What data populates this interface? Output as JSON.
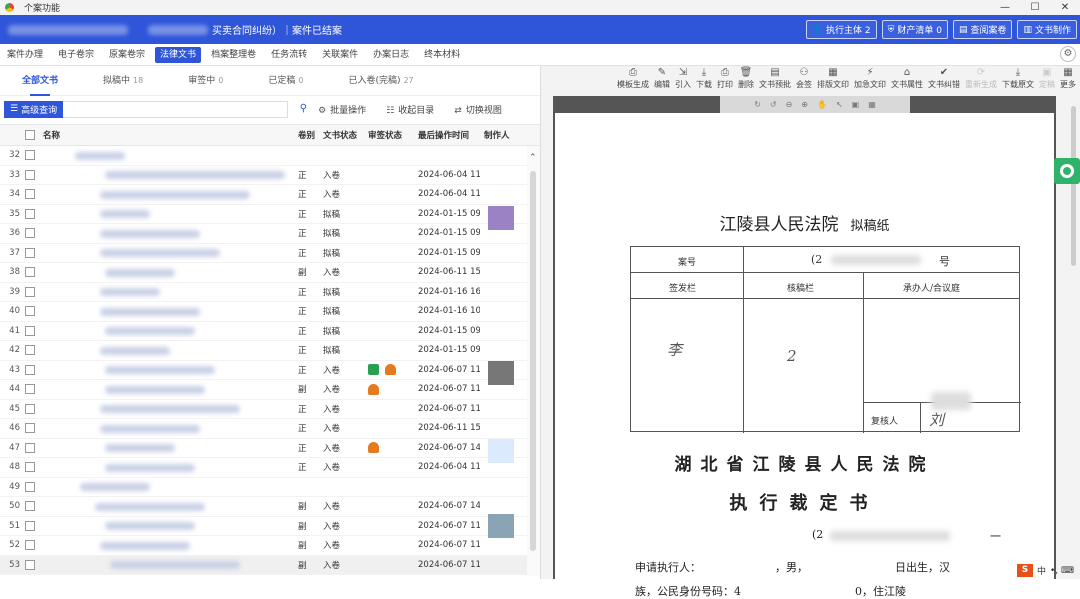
{
  "window": {
    "title": "个案功能",
    "buttons": [
      "—",
      "☐",
      "✕"
    ]
  },
  "header": {
    "case_status": "买卖合同纠纷）｜案件已结案",
    "buttons": [
      {
        "icon": "user-icon",
        "label": "执行主体 2"
      },
      {
        "icon": "shield-icon",
        "label": "财产清单 0"
      },
      {
        "icon": "book-icon",
        "label": "查阅案卷"
      },
      {
        "icon": "doc-icon",
        "label": "文书制作"
      }
    ]
  },
  "tabs": [
    "案件办理",
    "电子卷宗",
    "原案卷宗",
    "法律文书",
    "档案整理卷",
    "任务流转",
    "关联案件",
    "办案日志",
    "终本材料"
  ],
  "active_tab": "法律文书",
  "doc_tabs": [
    {
      "label": "全部文书",
      "count": ""
    },
    {
      "label": "拟稿中",
      "count": "18"
    },
    {
      "label": "审签中",
      "count": "0"
    },
    {
      "label": "已定稿",
      "count": "0"
    },
    {
      "label": "已入卷(完稿)",
      "count": "27"
    }
  ],
  "search": {
    "advanced_label": "高级查询"
  },
  "actions": [
    "批量操作",
    "收起目录",
    "切换视图"
  ],
  "columns": {
    "name": "名称",
    "vol": "卷别",
    "status": "文书状态",
    "audit": "审签状态",
    "time": "最后操作时间",
    "maker": "制作人"
  },
  "rows": [
    {
      "n": "32",
      "vol": "",
      "status": "",
      "time": "",
      "audit": []
    },
    {
      "n": "33",
      "vol": "正",
      "status": "入卷",
      "time": "2024-06-04 11:0",
      "audit": []
    },
    {
      "n": "34",
      "vol": "正",
      "status": "入卷",
      "time": "2024-06-04 11:0",
      "audit": []
    },
    {
      "n": "35",
      "vol": "正",
      "status": "拟稿",
      "time": "2024-01-15 09:3",
      "audit": []
    },
    {
      "n": "36",
      "vol": "正",
      "status": "拟稿",
      "time": "2024-01-15 09:3",
      "audit": []
    },
    {
      "n": "37",
      "vol": "正",
      "status": "拟稿",
      "time": "2024-01-15 09:3",
      "audit": []
    },
    {
      "n": "38",
      "vol": "副",
      "status": "入卷",
      "time": "2024-06-11 15:1",
      "audit": []
    },
    {
      "n": "39",
      "vol": "正",
      "status": "拟稿",
      "time": "2024-01-16 16:3",
      "audit": []
    },
    {
      "n": "40",
      "vol": "正",
      "status": "拟稿",
      "time": "2024-01-16 10:4",
      "audit": []
    },
    {
      "n": "41",
      "vol": "正",
      "status": "拟稿",
      "time": "2024-01-15 09:3",
      "audit": []
    },
    {
      "n": "42",
      "vol": "正",
      "status": "拟稿",
      "time": "2024-01-15 09:3",
      "audit": []
    },
    {
      "n": "43",
      "vol": "正",
      "status": "入卷",
      "time": "2024-06-07 11:5",
      "audit": [
        "green",
        "orange"
      ]
    },
    {
      "n": "44",
      "vol": "副",
      "status": "入卷",
      "time": "2024-06-07 11:5",
      "audit": [
        "orange"
      ]
    },
    {
      "n": "45",
      "vol": "正",
      "status": "入卷",
      "time": "2024-06-07 11:5",
      "audit": []
    },
    {
      "n": "46",
      "vol": "正",
      "status": "入卷",
      "time": "2024-06-11 15:1",
      "audit": []
    },
    {
      "n": "47",
      "vol": "正",
      "status": "入卷",
      "time": "2024-06-07 14:34",
      "audit": [
        "orange"
      ]
    },
    {
      "n": "48",
      "vol": "正",
      "status": "入卷",
      "time": "2024-06-04 11:0",
      "audit": []
    },
    {
      "n": "49",
      "vol": "",
      "status": "",
      "time": "",
      "audit": []
    },
    {
      "n": "50",
      "vol": "副",
      "status": "入卷",
      "time": "2024-06-07 14:34",
      "audit": []
    },
    {
      "n": "51",
      "vol": "副",
      "status": "入卷",
      "time": "2024-06-07 11:30",
      "audit": []
    },
    {
      "n": "52",
      "vol": "副",
      "status": "入卷",
      "time": "2024-06-07 11:24",
      "audit": []
    },
    {
      "n": "53",
      "vol": "副",
      "status": "入卷",
      "time": "2024-06-07 11:2",
      "audit": []
    }
  ],
  "toolbar": [
    {
      "icon": "template-icon",
      "label": "模板生成",
      "enabled": true
    },
    {
      "icon": "edit-icon",
      "label": "编辑",
      "enabled": true
    },
    {
      "icon": "import-icon",
      "label": "引入",
      "enabled": true
    },
    {
      "icon": "download-icon",
      "label": "下载",
      "enabled": true
    },
    {
      "icon": "print-icon",
      "label": "打印",
      "enabled": true
    },
    {
      "icon": "delete-icon",
      "label": "删除",
      "enabled": true
    },
    {
      "icon": "preview-icon",
      "label": "文书预批",
      "enabled": true
    },
    {
      "icon": "countersign-icon",
      "label": "会签",
      "enabled": true
    },
    {
      "icon": "layout-icon",
      "label": "排版文印",
      "enabled": true
    },
    {
      "icon": "urgent-icon",
      "label": "加急文印",
      "enabled": true
    },
    {
      "icon": "tag-icon",
      "label": "文书属性",
      "enabled": true
    },
    {
      "icon": "correct-icon",
      "label": "文书纠错",
      "enabled": true
    },
    {
      "icon": "regen-icon",
      "label": "重新生成",
      "enabled": false
    },
    {
      "icon": "download-orig-icon",
      "label": "下载原文",
      "enabled": true
    },
    {
      "icon": "finalize-icon",
      "label": "定稿",
      "enabled": false
    },
    {
      "icon": "more-icon",
      "label": "更多",
      "enabled": true
    }
  ],
  "viewer_tools": [
    "↻",
    "↺",
    "⊖",
    "⊕",
    "✋",
    "↖",
    "▣",
    "▦"
  ],
  "document": {
    "court": "江陵县人民法院",
    "draft": "拟稿纸",
    "case_no_label": "案号",
    "case_no_prefix": "(2",
    "case_no_suffix": "号",
    "issue_label": "签发栏",
    "review_label": "核稿栏",
    "handler_label": "承办人/合议庭",
    "recheck_label": "复核人",
    "sig1": "李",
    "sig2": "2",
    "sig3": "刘",
    "court_full": "湖北省江陵县人民法院",
    "doc_title": "执行裁定书",
    "line_no": "(2",
    "para1a": "申请执行人：",
    "para1b": "，男，",
    "para1c": "日出生，汉",
    "para2a": "族，公民身份号码：4",
    "para2b": "0，住江陵",
    "dash": "一"
  },
  "ime": {
    "s": "S",
    "label": "中",
    "marks": "•, ⌨"
  }
}
